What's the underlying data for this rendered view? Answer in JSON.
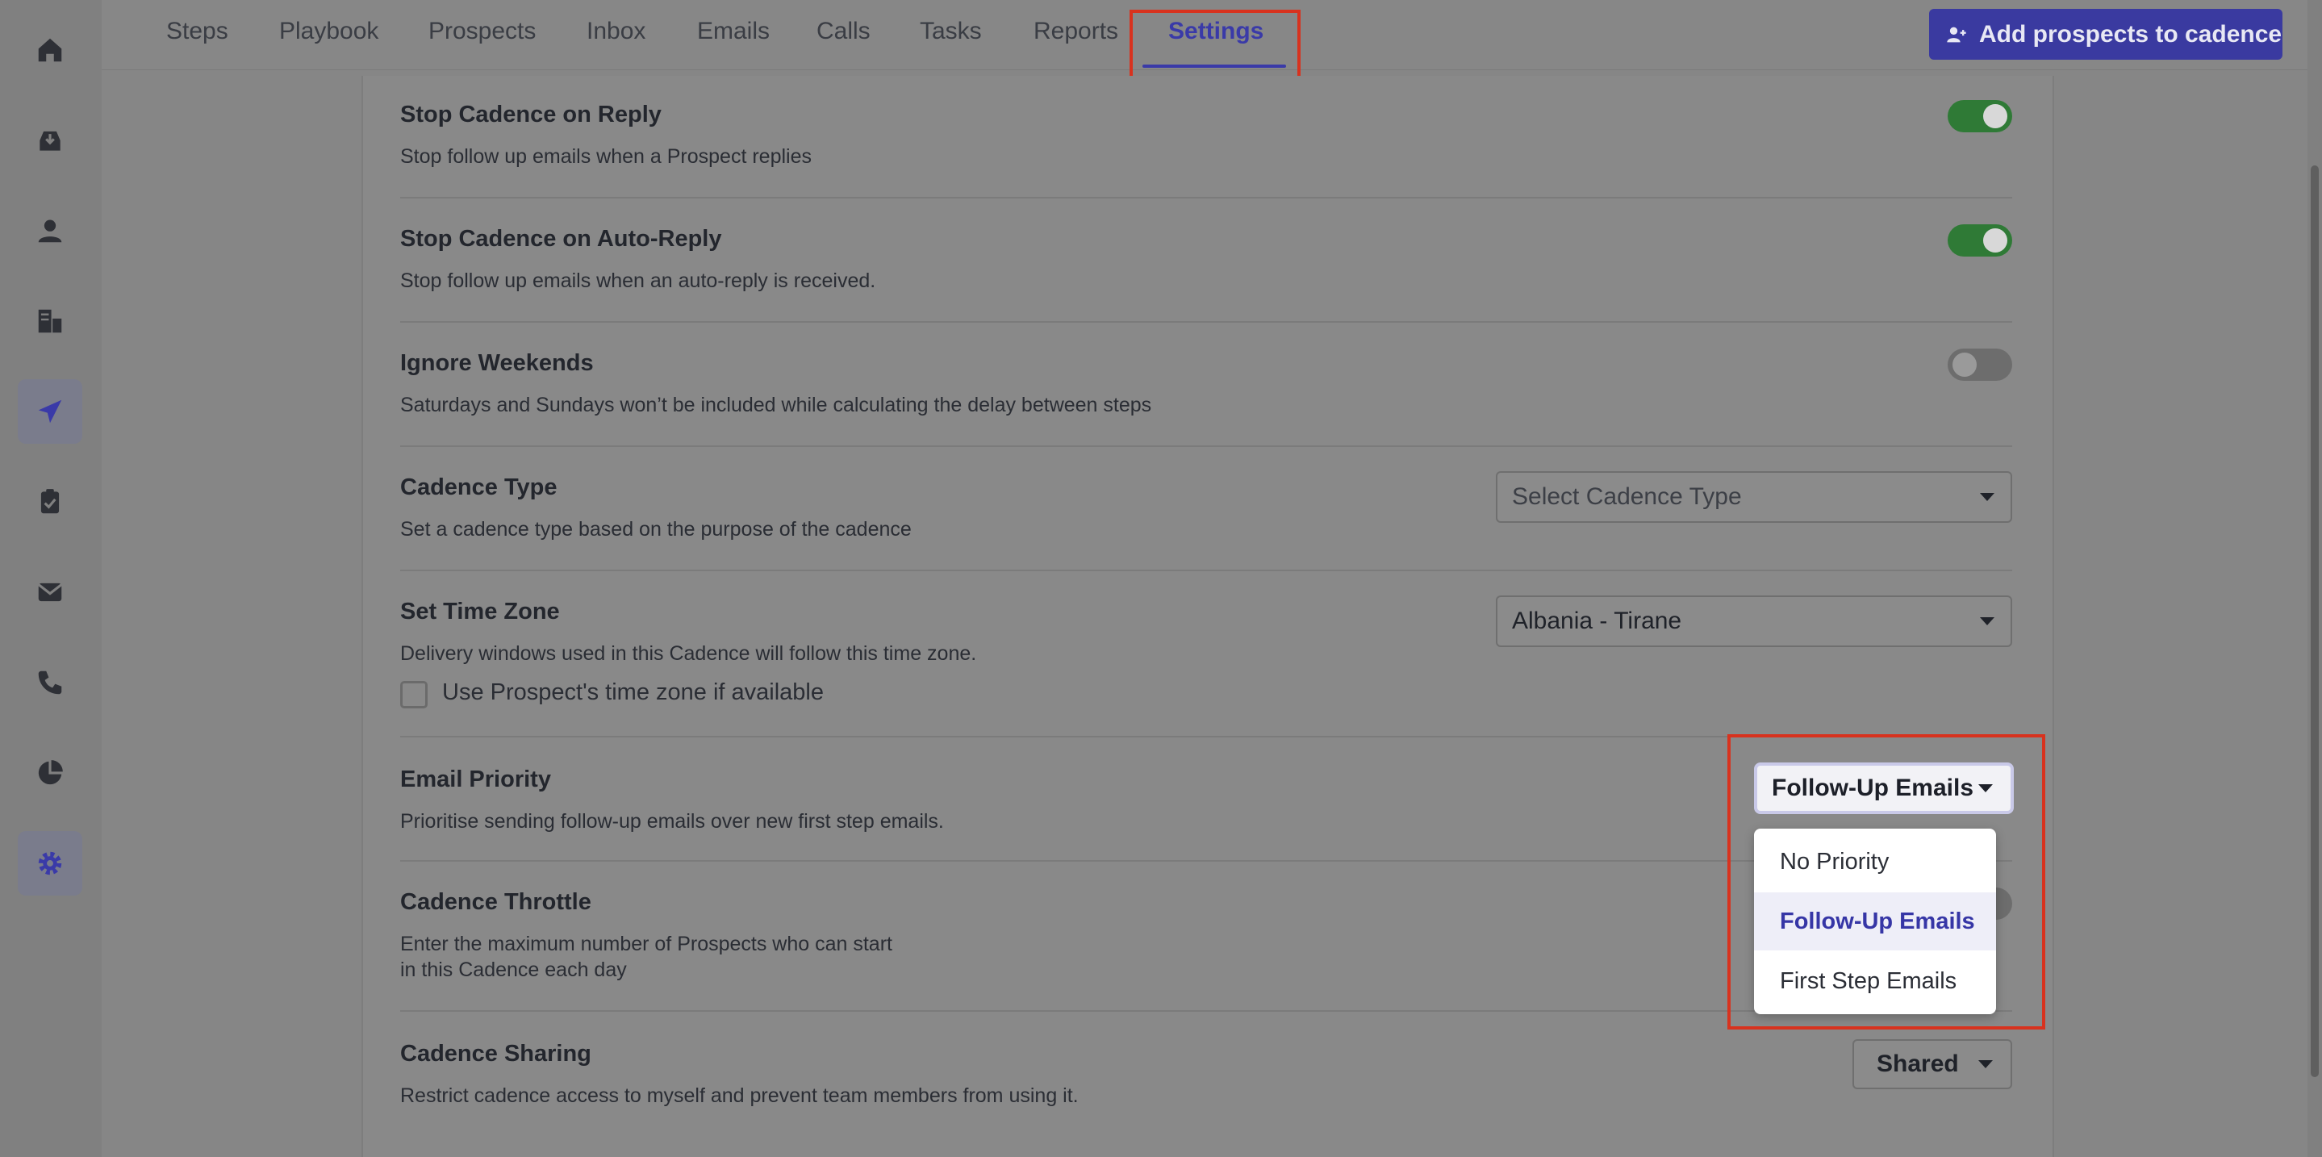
{
  "sidebar": {
    "items": [
      {
        "icon": "home-icon"
      },
      {
        "icon": "inbox-download-icon"
      },
      {
        "icon": "person-icon"
      },
      {
        "icon": "accounts-icon"
      },
      {
        "icon": "paper-plane-icon",
        "active": true
      },
      {
        "icon": "clipboard-check-icon"
      },
      {
        "icon": "mail-icon"
      },
      {
        "icon": "phone-icon"
      },
      {
        "icon": "pie-chart-icon"
      },
      {
        "icon": "gear-icon",
        "active": true
      }
    ]
  },
  "tabs": [
    "Steps",
    "Playbook",
    "Prospects",
    "Inbox",
    "Emails",
    "Calls",
    "Tasks",
    "Reports",
    "Settings"
  ],
  "active_tab": "Settings",
  "add_button_label": "Add prospects to cadence",
  "settings": {
    "stop_on_reply": {
      "title": "Stop Cadence on Reply",
      "desc": "Stop follow up emails when a Prospect replies",
      "enabled": true
    },
    "stop_on_auto_reply": {
      "title": "Stop Cadence on Auto-Reply",
      "desc": "Stop follow up emails when an auto-reply is received.",
      "enabled": true
    },
    "ignore_weekends": {
      "title": "Ignore Weekends",
      "desc": "Saturdays and Sundays won’t be included while calculating the delay between steps",
      "enabled": false
    },
    "cadence_type": {
      "title": "Cadence Type",
      "desc": "Set a cadence type based on the purpose of the cadence",
      "placeholder": "Select Cadence Type"
    },
    "time_zone": {
      "title": "Set Time Zone",
      "desc": "Delivery windows used in this Cadence will follow this time zone.",
      "value": "Albania - Tirane",
      "checkbox_label": "Use Prospect's time zone if available"
    },
    "email_priority": {
      "title": "Email Priority",
      "desc": "Prioritise sending follow-up emails over new first step emails.",
      "value": "Follow-Up Emails",
      "options": [
        "No Priority",
        "Follow-Up Emails",
        "First Step Emails"
      ]
    },
    "throttle": {
      "title": "Cadence Throttle",
      "desc_line1": "Enter the maximum number of Prospects who can start",
      "desc_line2": "in this Cadence each day"
    },
    "sharing": {
      "title": "Cadence Sharing",
      "desc": "Restrict cadence access to myself and prevent team members from using it.",
      "value": "Shared"
    }
  },
  "colors": {
    "accent": "#3a3aa8",
    "toggle_on": "#2f7a36",
    "highlight": "#d8321e"
  }
}
